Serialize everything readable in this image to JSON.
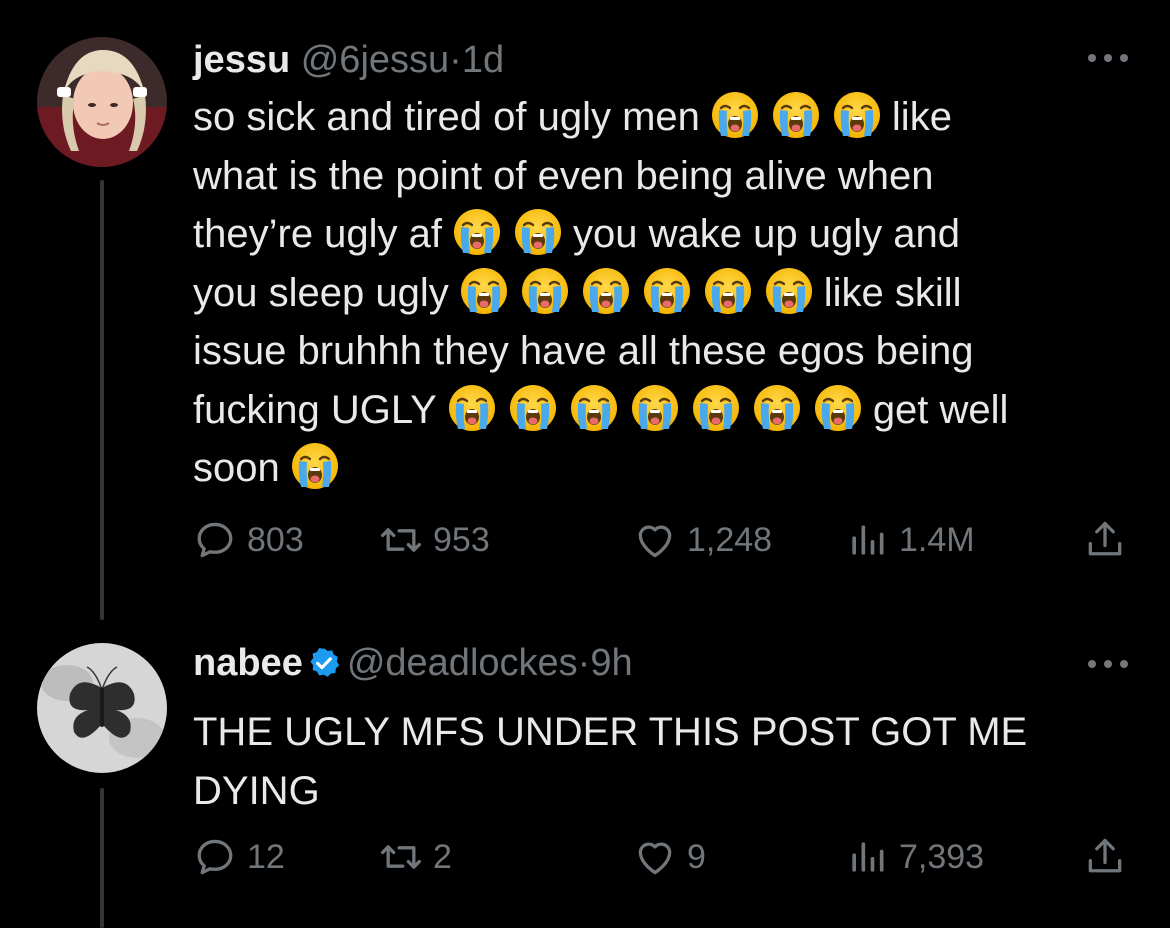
{
  "colors": {
    "background": "#000000",
    "primary_text": "#e7e9ea",
    "secondary_text": "#71767b",
    "verified_blue": "#1d9bf0",
    "thread_line": "#333639"
  },
  "tweets": [
    {
      "display_name": "jessu",
      "handle": "@6jessu",
      "separator": "·",
      "time": "1d",
      "verified": false,
      "text_lines": [
        [
          "so sick and tired of ugly men",
          "E",
          "E",
          "E",
          "like"
        ],
        [
          "what is the point of even being alive when"
        ],
        [
          "they’re ugly af",
          "E",
          "E",
          "you wake up ugly and"
        ],
        [
          "you sleep ugly",
          "E",
          "E",
          "E",
          "E",
          "E",
          "E",
          "like skill"
        ],
        [
          "issue bruhhh they have all these egos being"
        ],
        [
          "fucking UGLY",
          "E",
          "E",
          "E",
          "E",
          "E",
          "E",
          "E",
          "get well"
        ],
        [
          "soon",
          "E"
        ]
      ],
      "emoji_name": "loudly-crying-face-emoji",
      "stats": {
        "replies": "803",
        "retweets": "953",
        "likes": "1,248",
        "views": "1.4M"
      }
    },
    {
      "display_name": "nabee",
      "handle": "@deadlockes",
      "separator": "·",
      "time": "9h",
      "verified": true,
      "text_lines": [
        [
          "THE UGLY MFS UNDER THIS POST GOT ME"
        ],
        [
          "DYING"
        ]
      ],
      "stats": {
        "replies": "12",
        "retweets": "2",
        "likes": "9",
        "views": "7,393"
      }
    }
  ],
  "icons": {
    "more": "more-horizontal-icon",
    "reply": "reply-bubble-icon",
    "retweet": "retweet-icon",
    "like": "heart-icon",
    "views": "views-bar-chart-icon",
    "share": "share-upload-icon",
    "verified": "verified-badge-icon"
  }
}
